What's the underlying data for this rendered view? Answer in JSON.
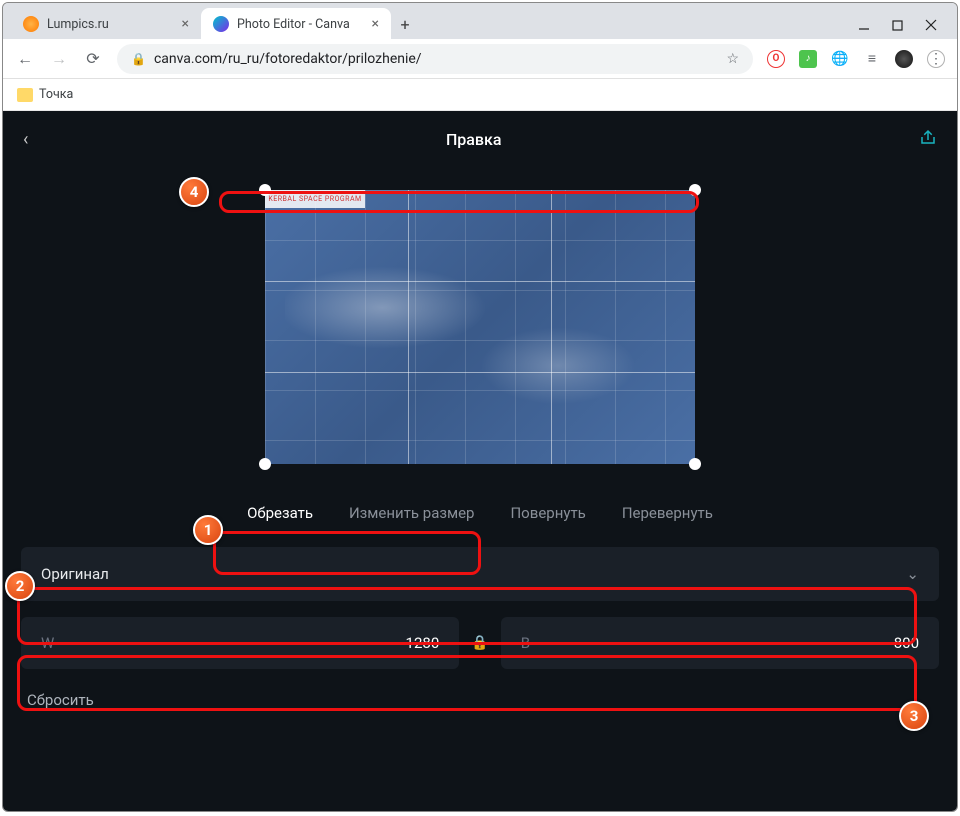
{
  "window": {
    "tabs": [
      {
        "title": "Lumpics.ru",
        "active": false
      },
      {
        "title": "Photo Editor - Canva",
        "active": true
      }
    ]
  },
  "address": {
    "url": "canva.com/ru_ru/fotoredaktor/prilozhenie/"
  },
  "bookmarks": {
    "item1": "Точка"
  },
  "app": {
    "title": "Правка",
    "watermark": "KERBAL SPACE PROGRAM",
    "tool_tabs": {
      "crop": "Обрезать",
      "resize": "Изменить размер",
      "rotate": "Повернуть",
      "flip": "Перевернуть"
    },
    "aspect_panel": {
      "label": "Оригинал"
    },
    "dims": {
      "w_label": "W",
      "w_value": "1280",
      "h_label": "В",
      "h_value": "800"
    },
    "reset": "Сбросить"
  },
  "annotations": {
    "b1": "1",
    "b2": "2",
    "b3": "3",
    "b4": "4"
  }
}
